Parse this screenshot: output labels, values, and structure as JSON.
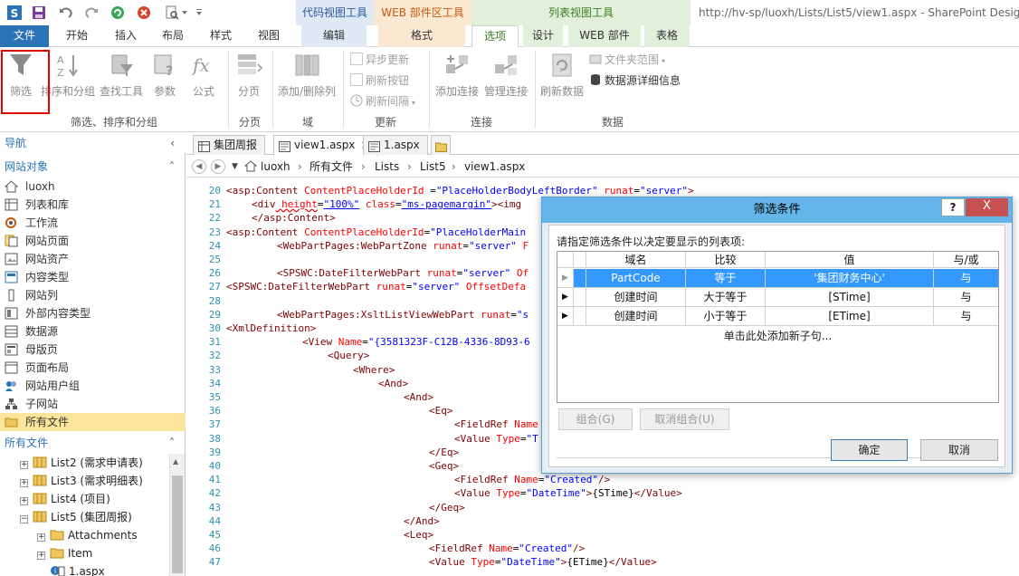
{
  "window_title": "http://hv-sp/luoxh/Lists/List5/view1.aspx - SharePoint Designer",
  "context_groups": [
    "代码视图工具",
    "WEB 部件区工具",
    "列表视图工具"
  ],
  "tabs": [
    "文件",
    "开始",
    "插入",
    "布局",
    "样式",
    "视图",
    "编辑",
    "格式",
    "选项",
    "设计",
    "WEB 部件",
    "表格"
  ],
  "ribbon": {
    "filter": "筛选",
    "sort_group": "排序和分组",
    "find_tool": "查找工具",
    "params": "参数",
    "formula": "公式",
    "paging": "分页",
    "add_remove_cols": "添加/删除列",
    "async_update": "异步更新",
    "refresh_button": "刷新按钮",
    "refresh_interval": "刷新间隔",
    "add_connection": "添加连接",
    "manage_connections": "管理连接",
    "refresh_data": "刷新数据",
    "folder_scope": "文件夹范围",
    "datasource_details": "数据源详细信息",
    "groups": [
      "筛选、排序和分组",
      "分页",
      "域",
      "更新",
      "连接",
      "数据"
    ]
  },
  "nav": {
    "title": "导航",
    "site_objects_title": "网站对象",
    "site_objects": [
      "luoxh",
      "列表和库",
      "工作流",
      "网站页面",
      "网站资产",
      "内容类型",
      "网站列",
      "外部内容类型",
      "数据源",
      "母版页",
      "页面布局",
      "网站用户组",
      "子网站",
      "所有文件"
    ],
    "all_files_title": "所有文件",
    "tree": [
      "List2 (需求申请表)",
      "List3 (需求明细表)",
      "List4 (项目)",
      "List5 (集团周报)",
      "Attachments",
      "Item",
      "1.aspx"
    ]
  },
  "doc_tabs": [
    "集团周报",
    "view1.aspx",
    "1.aspx"
  ],
  "breadcrumb": [
    "luoxh",
    "所有文件",
    "Lists",
    "List5",
    "view1.aspx"
  ],
  "code": {
    "numbers": [
      "20",
      "21",
      "22",
      "23",
      "24",
      "25",
      "26",
      "27",
      "28",
      "29",
      "30",
      "31",
      "32",
      "33",
      "34",
      "35",
      "36",
      "37",
      "38",
      "39",
      "40",
      "41",
      "42",
      "43",
      "44",
      "45",
      "46",
      "47"
    ],
    "l20": [
      "<asp:Content",
      " ContentPlaceHolderId",
      " =",
      "\"PlaceHolderBodyLeftBorder\"",
      " runat",
      "=",
      "\"server\"",
      ">"
    ],
    "l21": [
      "<div",
      " height",
      "=",
      "\"100%\"",
      " class",
      "=",
      "\"ms-pagemargin\"",
      "><img"
    ],
    "l22": "</asp:Content>",
    "l23": [
      "<asp:Content",
      " ContentPlaceHolderId",
      "=",
      "\"PlaceHolderMain"
    ],
    "l24": [
      "<WebPartPages:WebPartZone",
      " runat",
      "=",
      "\"server\"",
      " F"
    ],
    "l26": [
      "<SPSWC:DateFilterWebPart",
      " runat",
      "=",
      "\"server\"",
      " Of"
    ],
    "l27": [
      "<SPSWC:DateFilterWebPart",
      " runat",
      "=",
      "\"server\"",
      " OffsetDefa"
    ],
    "l29": [
      "<WebPartPages:XsltListViewWebPart",
      " runat",
      "=",
      "\"s"
    ],
    "l30": "<XmlDefinition>",
    "l31": [
      "<View",
      " Name",
      "=",
      "\"{3581323F-C12B-4336-8D93-6"
    ],
    "l32": "<Query>",
    "l33": "<Where>",
    "l34": "<And>",
    "l35": "<And>",
    "l36": "<Eq>",
    "l37": [
      "<FieldRef",
      " Name"
    ],
    "l38": [
      "<Value",
      " Type",
      "=",
      "\"T"
    ],
    "l39": "</Eq>",
    "l40": "<Geq>",
    "l41": [
      "<FieldRef",
      " Name",
      "=",
      "\"Created\"",
      "/>"
    ],
    "l42": [
      "<Value",
      " Type",
      "=",
      "\"DateTime\"",
      ">",
      "{STime}",
      "</Value>"
    ],
    "l43": "</Geq>",
    "l44": "</And>",
    "l45": "<Leq>",
    "l46": [
      "<FieldRef",
      " Name",
      "=",
      "\"Created\"",
      "/>"
    ],
    "l47": [
      "<Value",
      " Type",
      "=",
      "\"DateTime\"",
      ">",
      "{ETime}",
      "</Value>"
    ]
  },
  "dialog": {
    "title": "筛选条件",
    "help": "?",
    "close": "X",
    "instruction": "请指定筛选条件以决定要显示的列表项:",
    "columns": [
      "域名",
      "比较",
      "值",
      "与/或"
    ],
    "rows": [
      {
        "field": "PartCode",
        "op": "等于",
        "value": "'集团财务中心'",
        "andor": "与"
      },
      {
        "field": "创建时间",
        "op": "大于等于",
        "value": "[STime]",
        "andor": "与"
      },
      {
        "field": "创建时间",
        "op": "小于等于",
        "value": "[ETime]",
        "andor": "与"
      }
    ],
    "add_clause": "单击此处添加新子句...",
    "group_btn": "组合(G)",
    "ungroup_btn": "取消组合(U)",
    "ok": "确定",
    "cancel": "取消"
  },
  "colors": {
    "accent": "#2b73b7",
    "selection": "#3399ff",
    "highlight": "#e00000",
    "dialog_title": "#64b6e8"
  }
}
